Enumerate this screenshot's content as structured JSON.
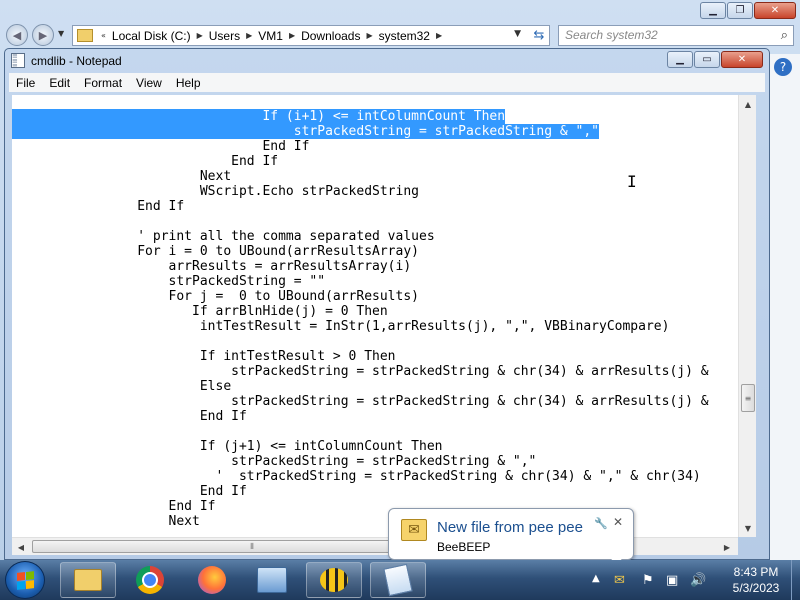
{
  "explorer": {
    "breadcrumb": [
      "Local Disk (C:)",
      "Users",
      "VM1",
      "Downloads",
      "system32"
    ],
    "search_placeholder": "Search system32"
  },
  "notepad": {
    "title": "cmdlib - Notepad",
    "menu": [
      "File",
      "Edit",
      "Format",
      "View",
      "Help"
    ],
    "code_lines": [
      "                                If (i+1) <= intColumnCount Then",
      "                                    strPackedString = strPackedString & \",\"",
      "                                End If",
      "                            End If",
      "                        Next",
      "                        WScript.Echo strPackedString",
      "                End If",
      "",
      "                ' print all the comma separated values",
      "                For i = 0 to UBound(arrResultsArray)",
      "                    arrResults = arrResultsArray(i)",
      "                    strPackedString = \"\"",
      "                    For j =  0 to UBound(arrResults)",
      "                       If arrBlnHide(j) = 0 Then",
      "                        intTestResult = InStr(1,arrResults(j), \",\", VBBinaryCompare)",
      "",
      "                        If intTestResult > 0 Then",
      "                            strPackedString = strPackedString & chr(34) & arrResults(j) &",
      "                        Else",
      "                            strPackedString = strPackedString & chr(34) & arrResults(j) &",
      "                        End If",
      "",
      "                        If (j+1) <= intColumnCount Then",
      "                            strPackedString = strPackedString & \",\"",
      "                          '  strPackedString = strPackedString & chr(34) & \",\" & chr(34)",
      "                        End If",
      "                    End If",
      "                    Next"
    ],
    "highlighted_lines": 2
  },
  "notification": {
    "title": "New file from pee pee",
    "app": "BeeBEEP"
  },
  "taskbar": {
    "time": "8:43 PM",
    "date": "5/3/2023"
  },
  "colors": {
    "selection": "#3399ff",
    "toast_title": "#1b4f8f"
  }
}
